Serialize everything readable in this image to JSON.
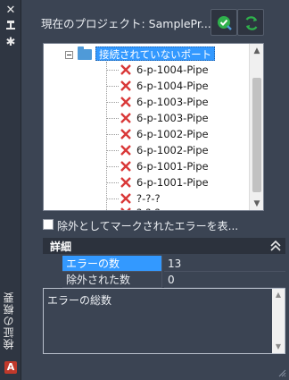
{
  "palette": {
    "title": "検証の概要",
    "logo": "A",
    "buttons": [
      "close-icon",
      "auto-hide-icon",
      "properties-icon"
    ]
  },
  "header": {
    "project_label": "現在のプロジェクト: SamplePr...",
    "actions": [
      "validate-icon",
      "refresh-icon"
    ]
  },
  "tree": {
    "root": "接続されていないポート",
    "items": [
      "6-p-1004-Pipe",
      "6-p-1004-Pipe",
      "6-p-1003-Pipe",
      "6-p-1003-Pipe",
      "6-p-1002-Pipe",
      "6-p-1002-Pipe",
      "6-p-1001-Pipe",
      "6-p-1001-Pipe",
      "?-?-?",
      "?-?-?"
    ]
  },
  "filter": {
    "checkbox_label": "除外としてマークされたエラーを表...",
    "checked": false
  },
  "details": {
    "title": "詳細",
    "rows": [
      {
        "key": "エラーの数",
        "value": "13"
      },
      {
        "key": "除外された数",
        "value": "0"
      }
    ]
  },
  "description": {
    "text": "エラーの総数"
  },
  "colors": {
    "panel_bg": "#3b4453",
    "selection": "#3399ff",
    "error_red": "#d93838",
    "accent_green": "#2fb14c"
  }
}
